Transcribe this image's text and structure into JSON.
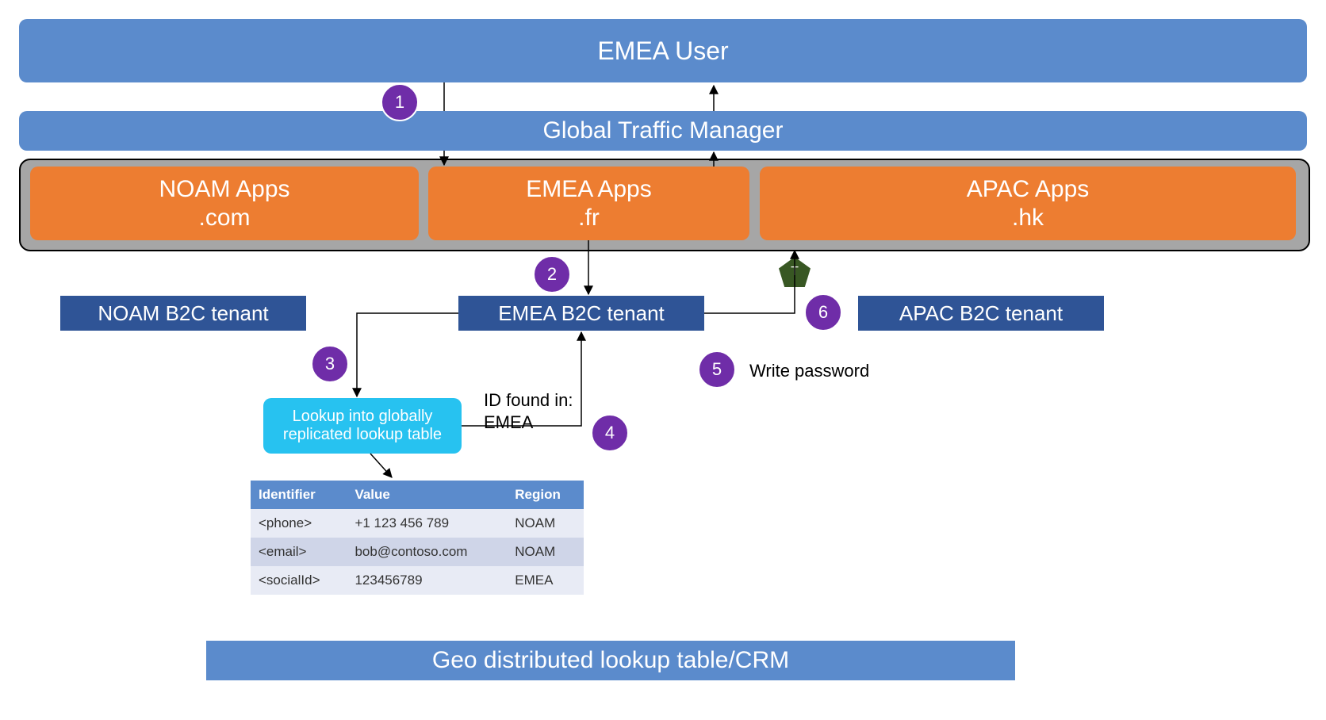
{
  "top_user": "EMEA User",
  "gtm": "Global Traffic Manager",
  "apps": {
    "noam": {
      "l1": "NOAM Apps",
      "l2": ".com"
    },
    "emea": {
      "l1": "EMEA Apps",
      "l2": ".fr"
    },
    "apac": {
      "l1": "APAC Apps",
      "l2": ".hk"
    }
  },
  "tenants": {
    "noam": "NOAM B2C tenant",
    "emea": "EMEA B2C tenant",
    "apac": "APAC B2C tenant"
  },
  "lookup_box": "Lookup into globally replicated lookup table",
  "id_found_l1": "ID found in:",
  "id_found_l2": "EMEA",
  "write_pw": "Write password",
  "geo": "Geo distributed lookup table/CRM",
  "token_badge": "T",
  "steps": {
    "s1": "1",
    "s2": "2",
    "s3": "3",
    "s4": "4",
    "s5": "5",
    "s6": "6"
  },
  "table": {
    "headers": {
      "c1": "Identifier",
      "c2": "Value",
      "c3": "Region"
    },
    "rows": [
      {
        "c1": "<phone>",
        "c2": "+1 123 456 789",
        "c3": "NOAM"
      },
      {
        "c1": "<email>",
        "c2": "bob@contoso.com",
        "c3": "NOAM"
      },
      {
        "c1": "<socialId>",
        "c2": "123456789",
        "c3": "EMEA"
      }
    ]
  }
}
